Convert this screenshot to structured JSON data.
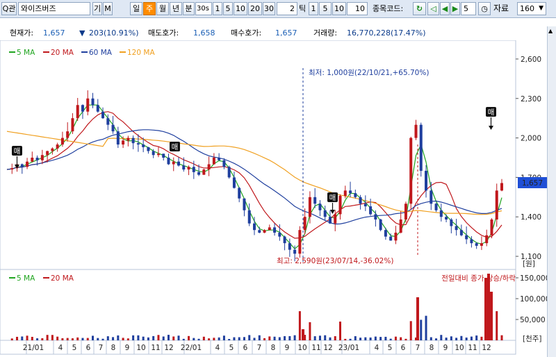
{
  "toolbar": {
    "search_icon_label": "Q",
    "search_sub": "관",
    "stock_name": "와이즈버즈",
    "tag1": "기",
    "tag2": "M",
    "periods": [
      "일",
      "주",
      "월",
      "년",
      "분"
    ],
    "active_period_index": 1,
    "minute_select": "30s",
    "nums": [
      "1",
      "5",
      "10",
      "20",
      "30"
    ],
    "tick_value": "2",
    "tick_label": "틱",
    "tick_nums": [
      "1",
      "5",
      "10"
    ],
    "tick_count": "10",
    "code_label": "종목코드:",
    "count_value": "5",
    "data_label": "자료",
    "data_count": "160"
  },
  "info": {
    "price_label": "현재가:",
    "price": "1,657",
    "change_arrow": "▼",
    "change": "203(10.91%)",
    "ask_label": "매도호가:",
    "ask": "1,658",
    "bid_label": "매수호가:",
    "bid": "1,657",
    "volume_label": "거래량:",
    "volume": "16,770,228(17.47%)"
  },
  "legend_top": [
    {
      "label": "5 MA",
      "color": "#1fa51f"
    },
    {
      "label": "20 MA",
      "color": "#c0181c"
    },
    {
      "label": "60 MA",
      "color": "#1f3f9e"
    },
    {
      "label": "120 MA",
      "color": "#f0a020"
    }
  ],
  "legend_bottom": [
    {
      "label": "5 MA",
      "color": "#1fa51f"
    },
    {
      "label": "20 MA",
      "color": "#c0181c"
    }
  ],
  "annotations": {
    "low": "최저: 1,000원(22/10/21,+65.70%)",
    "high": "최고: 2,590원(23/07/14,-36.02%)",
    "volume_title": "전일대비 종가 상승/하락",
    "sell_badge": "매"
  },
  "price_axis": {
    "ticks": [
      "2,600",
      "2,300",
      "2,000",
      "1,700",
      "1,400",
      "1,100"
    ],
    "unit": "[원]",
    "current": "1,657",
    "current_color": "#1f4fd6"
  },
  "volume_axis": {
    "ticks": [
      "150,000",
      "100,000",
      "50,000"
    ],
    "unit": "[천주]"
  },
  "x_axis": {
    "labels": [
      "21/01",
      "4",
      "5",
      "6",
      "7",
      "8",
      "9",
      "10",
      "11",
      "12",
      "22/01",
      "4",
      "5",
      "6",
      "7",
      "8",
      "9",
      "10",
      "11",
      "12",
      "23/01",
      "4",
      "5",
      "6",
      "7",
      "8",
      "9",
      "10",
      "11",
      "12"
    ]
  },
  "chart_data": {
    "type": "candlestick",
    "ylim": [
      1000,
      2700
    ],
    "volume_ylim": [
      0,
      160000
    ],
    "up_color": "#c0181c",
    "down_color": "#1f3f9e",
    "x_labels": [
      "21/01",
      "4",
      "5",
      "6",
      "7",
      "8",
      "9",
      "10",
      "11",
      "12",
      "22/01",
      "4",
      "5",
      "6",
      "7",
      "8",
      "9",
      "10",
      "11",
      "12",
      "23/01",
      "4",
      "5",
      "6",
      "7",
      "8",
      "9",
      "10",
      "11",
      "12"
    ],
    "close_path": [
      1760,
      1770,
      1800,
      1780,
      1820,
      1850,
      1830,
      1870,
      1900,
      1920,
      1950,
      2000,
      2050,
      2150,
      2250,
      2200,
      2300,
      2250,
      2200,
      2150,
      2100,
      2050,
      1950,
      1980,
      2000,
      1960,
      1950,
      1930,
      1900,
      1870,
      1880,
      1850,
      1800,
      1820,
      1790,
      1760,
      1780,
      1740,
      1720,
      1760,
      1800,
      1850,
      1830,
      1780,
      1700,
      1620,
      1540,
      1450,
      1350,
      1300,
      1280,
      1300,
      1320,
      1280,
      1250,
      1200,
      1150,
      1120,
      1300,
      1400,
      1550,
      1500,
      1450,
      1400,
      1350,
      1420,
      1560,
      1600,
      1580,
      1550,
      1500,
      1480,
      1420,
      1380,
      1300,
      1250,
      1220,
      1280,
      1380,
      1500,
      2000,
      2100,
      1750,
      1600,
      1500,
      1450,
      1400,
      1380,
      1330,
      1300,
      1260,
      1230,
      1200,
      1180,
      1200,
      1260,
      1380,
      1600,
      1657
    ]
  }
}
